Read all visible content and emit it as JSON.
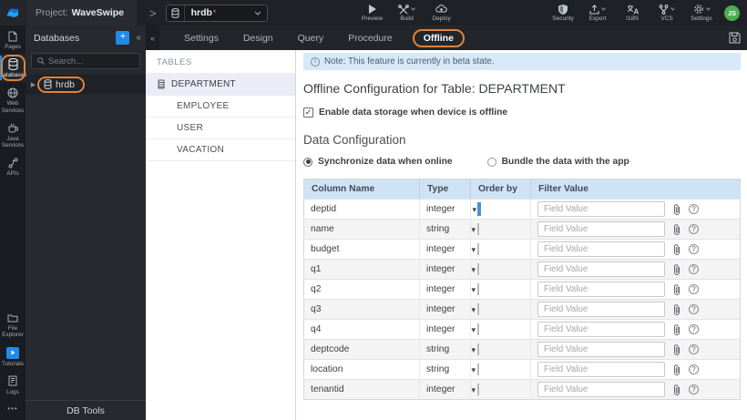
{
  "topbar": {
    "project_prefix": "Project:",
    "project_name": "WaveSwipe",
    "db_selector": {
      "value": "hrdb",
      "modified_marker": "*"
    },
    "left_actions": {
      "preview": "Preview",
      "build": "Build",
      "deploy": "Deploy"
    },
    "right_actions": {
      "security": "Security",
      "export": "Export",
      "i18n": "I18N",
      "vcs": "VCS",
      "settings": "Settings"
    },
    "avatar_initials": "JS"
  },
  "sidebar": {
    "top_items": [
      {
        "label": "Pages"
      },
      {
        "label": "Databases",
        "active": true
      },
      {
        "label": "Web Services"
      },
      {
        "label": "Java Services"
      },
      {
        "label": "APIs"
      }
    ],
    "bottom_items": [
      {
        "label": "File Explorer"
      },
      {
        "label": "Tutorials"
      },
      {
        "label": "Logs"
      }
    ],
    "more_label": "•••"
  },
  "db_panel": {
    "title": "Databases",
    "add_label": "+",
    "collapse_label": "«",
    "search_placeholder": "Search...",
    "items": [
      {
        "label": "hrdb"
      }
    ],
    "footer": "DB Tools"
  },
  "tabbar": {
    "collapse_label": "«",
    "tabs": [
      {
        "label": "Settings"
      },
      {
        "label": "Design"
      },
      {
        "label": "Query"
      },
      {
        "label": "Procedure"
      },
      {
        "label": "Offline",
        "active": true
      }
    ]
  },
  "tables_panel": {
    "title": "TABLES",
    "items": [
      {
        "label": "DEPARTMENT",
        "selected": true
      },
      {
        "label": "EMPLOYEE"
      },
      {
        "label": "USER"
      },
      {
        "label": "VACATION"
      }
    ]
  },
  "main": {
    "note": "Note: This feature is currently in beta state.",
    "title": "Offline Configuration for Table: DEPARTMENT",
    "enable_label": "Enable data storage when device is offline",
    "enable_checked": true,
    "check_glyph": "✓",
    "section_title": "Data Configuration",
    "radio_options": [
      {
        "label": "Synchronize data when online",
        "selected": true
      },
      {
        "label": "Bundle the data with the app",
        "selected": false
      }
    ],
    "table": {
      "headers": [
        "Column Name",
        "Type",
        "Order by",
        "Filter Value"
      ],
      "filter_placeholder": "Field Value",
      "select_caret": "▾",
      "help_glyph": "?",
      "rows": [
        {
          "name": "deptid",
          "type": "integer",
          "focused": true
        },
        {
          "name": "name",
          "type": "string"
        },
        {
          "name": "budget",
          "type": "integer"
        },
        {
          "name": "q1",
          "type": "integer"
        },
        {
          "name": "q2",
          "type": "integer"
        },
        {
          "name": "q3",
          "type": "integer"
        },
        {
          "name": "q4",
          "type": "integer"
        },
        {
          "name": "deptcode",
          "type": "string"
        },
        {
          "name": "location",
          "type": "string"
        },
        {
          "name": "tenantid",
          "type": "integer"
        }
      ]
    }
  },
  "colors": {
    "accent_blue": "#1f8ceb",
    "annotation_orange": "#e0833c",
    "note_bg": "#d7e9f8",
    "table_header_bg": "#cfe3f4",
    "avatar_green": "#4caf50",
    "topbar_bg": "#1e2226"
  }
}
